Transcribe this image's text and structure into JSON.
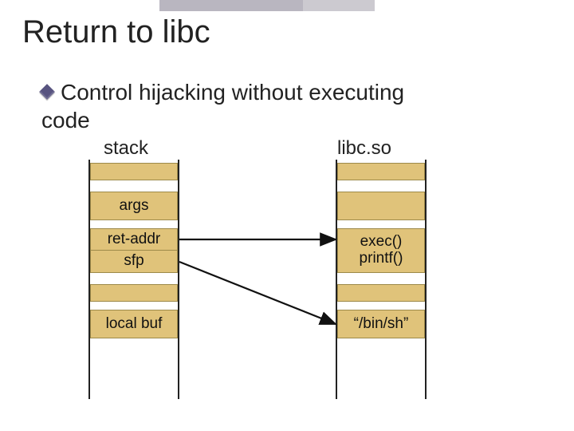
{
  "title": "Return to libc",
  "bullet": {
    "line1": "Control hijacking without executing",
    "line2": "code"
  },
  "labels": {
    "stack": "stack",
    "libc": "libc.so"
  },
  "stack": {
    "args": "args",
    "ret_addr": "ret-addr",
    "sfp": "sfp",
    "local_buf": "local buf"
  },
  "libc": {
    "exec": "exec()",
    "printf": "printf()",
    "binsh": "“/bin/sh”"
  },
  "chart_data": {
    "type": "diagram",
    "title": "Return to libc",
    "description": "Control hijacking without executing code",
    "columns": [
      {
        "name": "stack",
        "cells": [
          "",
          "args",
          "ret-addr",
          "sfp",
          "",
          "local buf"
        ]
      },
      {
        "name": "libc.so",
        "cells": [
          "",
          "",
          "exec()",
          "printf()",
          "",
          "\"/bin/sh\""
        ]
      }
    ],
    "arrows": [
      {
        "from": "stack.ret-addr",
        "to": "libc.exec()"
      },
      {
        "from": "stack.sfp",
        "to": "libc.\"/bin/sh\""
      }
    ]
  }
}
